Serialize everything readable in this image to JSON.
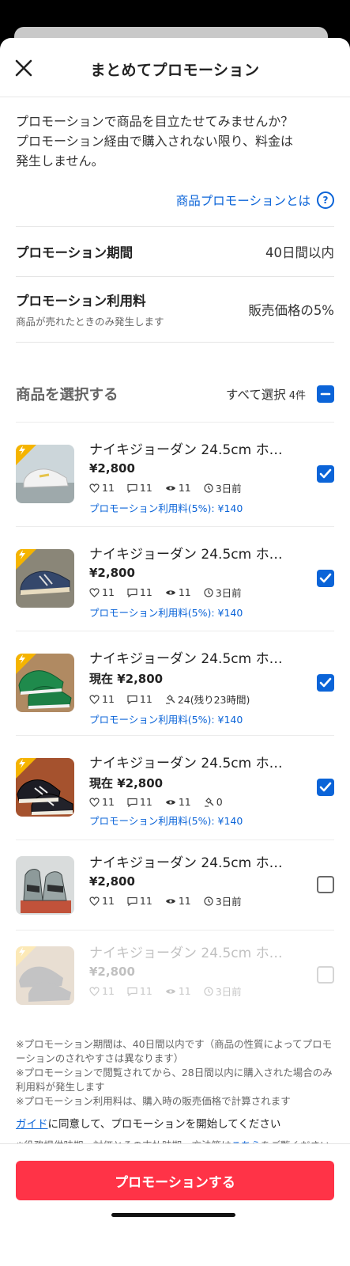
{
  "header": {
    "title": "まとめてプロモーション"
  },
  "intro": {
    "line1": "プロモーションで商品を目立たせてみませんか？",
    "line2": "プロモーション経由で購入されない限り、料金は",
    "line3": "発生しません。"
  },
  "about_link": {
    "label": "商品プロモーションとは",
    "icon": "question-circle-icon"
  },
  "period": {
    "label": "プロモーション期間",
    "value": "40日間以内"
  },
  "fee": {
    "label": "プロモーション利用料",
    "sub": "商品が売れたときのみ発生します",
    "value": "販売価格の5%"
  },
  "select": {
    "title": "商品を選択する",
    "all_label": "すべて選択",
    "count": "4件"
  },
  "items": [
    {
      "name": "ナイキジョーダン 24.5cm ホ…",
      "price": "¥2,800",
      "likes": "11",
      "comments": "11",
      "views": "11",
      "extra": "3日前",
      "promo_fee": "プロモーション利用料(5%): ¥140",
      "checked": true
    },
    {
      "name": "ナイキジョーダン 24.5cm ホ…",
      "price": "¥2,800",
      "likes": "11",
      "comments": "11",
      "views": "11",
      "extra": "3日前",
      "promo_fee": "プロモーション利用料(5%): ¥140",
      "checked": true
    },
    {
      "name": "ナイキジョーダン 24.5cm ホ…",
      "price": "現在 ¥2,800",
      "likes": "11",
      "comments": "11",
      "bids": "24(残り23時間)",
      "promo_fee": "プロモーション利用料(5%): ¥140",
      "checked": true
    },
    {
      "name": "ナイキジョーダン 24.5cm ホ…",
      "price": "現在 ¥2,800",
      "likes": "11",
      "comments": "11",
      "views": "11",
      "bids": "0",
      "promo_fee": "プロモーション利用料(5%): ¥140",
      "checked": true
    },
    {
      "name": "ナイキジョーダン 24.5cm ホ…",
      "price": "¥2,800",
      "likes": "11",
      "comments": "11",
      "views": "11",
      "extra": "3日前",
      "checked": false
    },
    {
      "name": "ナイキジョーダン 24.5cm ホ…",
      "price": "¥2,800",
      "likes": "11",
      "comments": "11",
      "views": "11",
      "extra": "3日前",
      "checked": false,
      "disabled": true
    }
  ],
  "notes": {
    "n1": "※プロモーション期間は、40日間以内です（商品の性質によってプロモーションのされやすさは異なります）",
    "n2": "※プロモーションで閲覧されてから、28日間以内に購入された場合のみ利用料が発生します",
    "n3": "※プロモーション利用料は、購入時の販売価格で計算されます"
  },
  "agree": {
    "guide": "ガイド",
    "text": "に同意して、プロモーションを開始してください"
  },
  "terms": {
    "text": "※役務提供時期、対価とその支払時期・方法等は",
    "link": "こちら",
    "tail": "をご覧ください"
  },
  "cta": {
    "label": "プロモーションする"
  },
  "colors": {
    "accent": "#0b64d8",
    "cta": "#ff3347",
    "badge": "#f5b400"
  }
}
